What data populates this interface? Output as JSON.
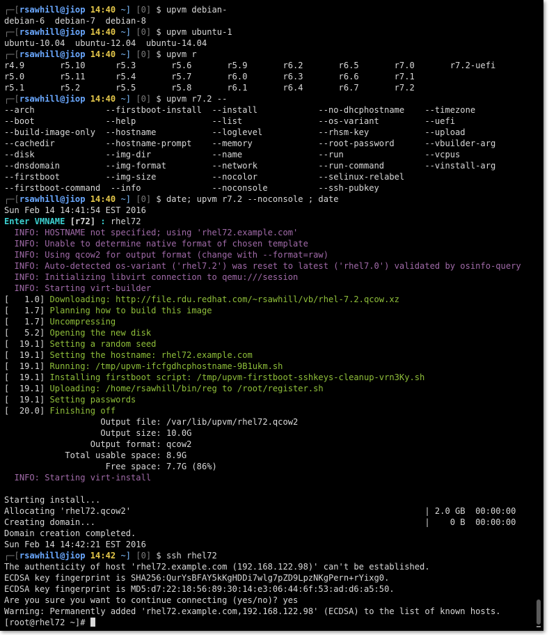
{
  "colors": {
    "terminal_background": "#000000",
    "default": "#d8d8d8",
    "prompt_bracket": "#7a7a7a",
    "user_host": "#6aa8ff",
    "time": "#e5c84a",
    "cwd": "#7fbfff",
    "exit": "#7a7a7a",
    "info": "#a06aa8",
    "progress": "#8fbf3a",
    "enter_vmname": "#3cd0d0",
    "value": "#d8d8d8"
  },
  "lines": [
    [
      {
        "t": "┌─[",
        "c": "prompt_bracket"
      },
      {
        "t": "rsawhill@jiop",
        "c": "user_host"
      },
      {
        "t": " 14:40",
        "c": "time"
      },
      {
        "t": " ~]",
        "c": "cwd"
      },
      {
        "t": " [0]",
        "c": "exit"
      },
      {
        "t": " $ upvm debian-",
        "c": "default"
      }
    ],
    [
      {
        "t": "debian-6  debian-7  debian-8",
        "c": "default"
      }
    ],
    [
      {
        "t": "┌─[",
        "c": "prompt_bracket"
      },
      {
        "t": "rsawhill@jiop",
        "c": "user_host"
      },
      {
        "t": " 14:40",
        "c": "time"
      },
      {
        "t": " ~]",
        "c": "cwd"
      },
      {
        "t": " [0]",
        "c": "exit"
      },
      {
        "t": " $ upvm ubuntu-1",
        "c": "default"
      }
    ],
    [
      {
        "t": "ubuntu-10.04  ubuntu-12.04  ubuntu-14.04",
        "c": "default"
      }
    ],
    [
      {
        "t": "┌─[",
        "c": "prompt_bracket"
      },
      {
        "t": "rsawhill@jiop",
        "c": "user_host"
      },
      {
        "t": " 14:40",
        "c": "time"
      },
      {
        "t": " ~]",
        "c": "cwd"
      },
      {
        "t": " [0]",
        "c": "exit"
      },
      {
        "t": " $ upvm r",
        "c": "default"
      }
    ],
    [
      {
        "t": "r4.9       r5.10      r5.3       r5.6       r5.9       r6.2       r6.5       r7.0       r7.2-uefi",
        "c": "default"
      }
    ],
    [
      {
        "t": "r5.0       r5.11      r5.4       r5.7       r6.0       r6.3       r6.6       r7.1",
        "c": "default"
      }
    ],
    [
      {
        "t": "r5.1       r5.2       r5.5       r5.8       r6.1       r6.4       r6.7       r7.2",
        "c": "default"
      }
    ],
    [
      {
        "t": "┌─[",
        "c": "prompt_bracket"
      },
      {
        "t": "rsawhill@jiop",
        "c": "user_host"
      },
      {
        "t": " 14:40",
        "c": "time"
      },
      {
        "t": " ~]",
        "c": "cwd"
      },
      {
        "t": " [0]",
        "c": "exit"
      },
      {
        "t": " $ upvm r7.2 --",
        "c": "default"
      }
    ],
    [
      {
        "t": "--arch              --firstboot-install  --install            --no-dhcphostname    --timezone",
        "c": "default"
      }
    ],
    [
      {
        "t": "--boot              --help               --list               --os-variant         --uefi",
        "c": "default"
      }
    ],
    [
      {
        "t": "--build-image-only  --hostname           --loglevel           --rhsm-key           --upload",
        "c": "default"
      }
    ],
    [
      {
        "t": "--cachedir          --hostname-prompt    --memory             --root-password      --vbuilder-arg",
        "c": "default"
      }
    ],
    [
      {
        "t": "--disk              --img-dir            --name               --run                --vcpus",
        "c": "default"
      }
    ],
    [
      {
        "t": "--dnsdomain         --img-format         --network            --run-command        --vinstall-arg",
        "c": "default"
      }
    ],
    [
      {
        "t": "--firstboot         --img-size           --nocolor            --selinux-relabel",
        "c": "default"
      }
    ],
    [
      {
        "t": "--firstboot-command  --info              --noconsole          --ssh-pubkey",
        "c": "default"
      }
    ],
    [
      {
        "t": "┌─[",
        "c": "prompt_bracket"
      },
      {
        "t": "rsawhill@jiop",
        "c": "user_host"
      },
      {
        "t": " 14:40",
        "c": "time"
      },
      {
        "t": " ~]",
        "c": "cwd"
      },
      {
        "t": " [0]",
        "c": "exit"
      },
      {
        "t": " $ date; upvm r7.2 --noconsole ; date",
        "c": "default"
      }
    ],
    [
      {
        "t": "Sun Feb 14 14:41:54 EST 2016",
        "c": "default"
      }
    ],
    [
      {
        "t": "Enter VMNAME ",
        "c": "enter_vmname",
        "b": true
      },
      {
        "t": "[r72]",
        "c": "default",
        "b": true
      },
      {
        "t": " : ",
        "c": "enter_vmname",
        "b": true
      },
      {
        "t": "rhel72",
        "c": "default"
      }
    ],
    [
      {
        "t": "  INFO: HOSTNAME not specified; using 'rhel72.example.com'",
        "c": "info"
      }
    ],
    [
      {
        "t": "  INFO: Unable to determine native format of chosen template",
        "c": "info"
      }
    ],
    [
      {
        "t": "  INFO: Using qcow2 for output format (change with --format=raw)",
        "c": "info"
      }
    ],
    [
      {
        "t": "  INFO: Auto-detected os-variant ('rhel7.2') was reset to latest ('rhel7.0') validated by osinfo-query",
        "c": "info"
      }
    ],
    [
      {
        "t": "  INFO: Initializing libvirt connection to qemu:///session",
        "c": "info"
      }
    ],
    [
      {
        "t": "  INFO: Starting virt-builder",
        "c": "info"
      }
    ],
    [
      {
        "t": "[   1.0] ",
        "c": "default"
      },
      {
        "t": "Downloading: http://file.rdu.redhat.com/~rsawhill/vb/rhel-7.2.qcow.xz",
        "c": "progress"
      }
    ],
    [
      {
        "t": "[   1.7] ",
        "c": "default"
      },
      {
        "t": "Planning how to build this image",
        "c": "progress"
      }
    ],
    [
      {
        "t": "[   1.7] ",
        "c": "default"
      },
      {
        "t": "Uncompressing",
        "c": "progress"
      }
    ],
    [
      {
        "t": "[   5.2] ",
        "c": "default"
      },
      {
        "t": "Opening the new disk",
        "c": "progress"
      }
    ],
    [
      {
        "t": "[  19.1] ",
        "c": "default"
      },
      {
        "t": "Setting a random seed",
        "c": "progress"
      }
    ],
    [
      {
        "t": "[  19.1] ",
        "c": "default"
      },
      {
        "t": "Setting the hostname: rhel72.example.com",
        "c": "progress"
      }
    ],
    [
      {
        "t": "[  19.1] ",
        "c": "default"
      },
      {
        "t": "Running: /tmp/upvm-ifcfgdhcphostname-9B1ukm.sh",
        "c": "progress"
      }
    ],
    [
      {
        "t": "[  19.1] ",
        "c": "default"
      },
      {
        "t": "Installing firstboot script: /tmp/upvm-firstboot-sshkeys-cleanup-vrn3Ky.sh",
        "c": "progress"
      }
    ],
    [
      {
        "t": "[  19.1] ",
        "c": "default"
      },
      {
        "t": "Uploading: /home/rsawhill/bin/reg to /root/register.sh",
        "c": "progress"
      }
    ],
    [
      {
        "t": "[  19.1] ",
        "c": "default"
      },
      {
        "t": "Setting passwords",
        "c": "progress"
      }
    ],
    [
      {
        "t": "[  20.0] ",
        "c": "default"
      },
      {
        "t": "Finishing off",
        "c": "progress"
      }
    ],
    [
      {
        "t": "                   Output file: /var/lib/upvm/rhel72.qcow2",
        "c": "default"
      }
    ],
    [
      {
        "t": "                   Output size: 10.0G",
        "c": "default"
      }
    ],
    [
      {
        "t": "                 Output format: qcow2",
        "c": "default"
      }
    ],
    [
      {
        "t": "            Total usable space: 8.9G",
        "c": "default"
      }
    ],
    [
      {
        "t": "                    Free space: 7.7G (86%)",
        "c": "default"
      }
    ],
    [
      {
        "t": "  INFO: Starting virt-install",
        "c": "info"
      }
    ],
    [
      {
        "t": "",
        "c": "default"
      }
    ],
    [
      {
        "t": "Starting install...",
        "c": "default"
      }
    ],
    [
      {
        "t": "Allocating 'rhel72.qcow2'                                                          | 2.0 GB  00:00:00",
        "c": "default"
      }
    ],
    [
      {
        "t": "Creating domain...                                                                 |    0 B  00:00:00",
        "c": "default"
      }
    ],
    [
      {
        "t": "Domain creation completed.",
        "c": "default"
      }
    ],
    [
      {
        "t": "Sun Feb 14 14:42:21 EST 2016",
        "c": "default"
      }
    ],
    [
      {
        "t": "┌─[",
        "c": "prompt_bracket"
      },
      {
        "t": "rsawhill@jiop",
        "c": "user_host"
      },
      {
        "t": " 14:42",
        "c": "time"
      },
      {
        "t": " ~]",
        "c": "cwd"
      },
      {
        "t": " [0]",
        "c": "exit"
      },
      {
        "t": " $ ssh rhel72",
        "c": "default"
      }
    ],
    [
      {
        "t": "The authenticity of host 'rhel72.example.com (192.168.122.98)' can't be established.",
        "c": "default"
      }
    ],
    [
      {
        "t": "ECDSA key fingerprint is SHA256:QurYsBFAY5kKgHDDi7wlg7pZD9LpzNKgPern+rYixg0.",
        "c": "default"
      }
    ],
    [
      {
        "t": "ECDSA key fingerprint is MD5:d7:22:18:56:89:30:14:e3:06:44:6f:53:ad:d6:a5:50.",
        "c": "default"
      }
    ],
    [
      {
        "t": "Are you sure you want to continue connecting (yes/no)? yes",
        "c": "default"
      }
    ],
    [
      {
        "t": "Warning: Permanently added 'rhel72.example.com,192.168.122.98' (ECDSA) to the list of known hosts.",
        "c": "default"
      }
    ],
    [
      {
        "t": "[root@rhel72 ~]# ",
        "c": "default"
      }
    ]
  ]
}
